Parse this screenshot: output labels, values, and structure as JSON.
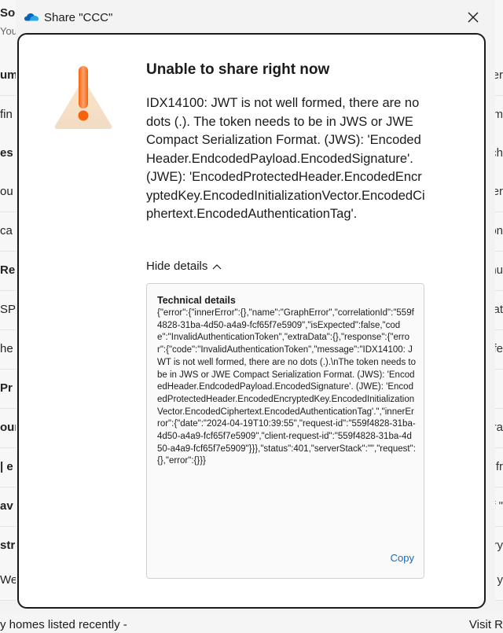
{
  "window": {
    "title": "Share \"CCC\""
  },
  "dialog": {
    "heading": "Unable to share right now",
    "message": "IDX14100: JWT is not well formed, there are no dots (.). The token needs to be in JWS or JWE Compact Serialization Format. (JWS): 'EncodedHeader.EndcodedPayload.EncodedSignature'. (JWE): 'EncodedProtectedHeader.EncodedEncryptedKey.EncodedInitializationVector.EncodedCiphertext.EncodedAuthenticationTag'.",
    "details_toggle": "Hide details",
    "tech_title": "Technical details",
    "tech_body": "{\"error\":{\"innerError\":{},\"name\":\"GraphError\",\"correlationId\":\"559f4828-31ba-4d50-a4a9-fcf65f7e5909\",\"isExpected\":false,\"code\":\"InvalidAuthenticationToken\",\"extraData\":{},\"response\":{\"error\":{\"code\":\"InvalidAuthenticationToken\",\"message\":\"IDX14100: JWT is not well formed, there are no dots (.).\\nThe token needs to be in JWS or JWE Compact Serialization Format. (JWS): 'EncodedHeader.EndcodedPayload.EncodedSignature'. (JWE): 'EncodedProtectedHeader.EncodedEncryptedKey.EncodedInitializationVector.EncodedCiphertext.EncodedAuthenticationTag'.\",\"innerError\":{\"date\":\"2024-04-19T10:39:55\",\"request-id\":\"559f4828-31ba-4d50-a4a9-fcf65f7e5909\",\"client-request-id\":\"559f4828-31ba-4d50-a4a9-fcf65f7e5909\"}}},\"status\":401,\"serverStack\":\"\",\"request\":{},\"error\":{}}}",
    "copy_label": "Copy"
  },
  "background": {
    "rows": [
      {
        "left": "So",
        "right": "",
        "bold": true
      },
      {
        "left": "You",
        "right": "",
        "bold": false
      },
      {
        "left": "um",
        "right": "ser",
        "bold": true
      },
      {
        "left": " fin",
        "right": "kim",
        "bold": false
      },
      {
        "left": "es",
        "right": "sch",
        "bold": true
      },
      {
        "left": "ou p",
        "right": "ter",
        "bold": false
      },
      {
        "left": "ca",
        "right": "on",
        "bold": false
      },
      {
        "left": "Re",
        "right": "nu",
        "bold": true
      },
      {
        "left": "SPI",
        "right": "at",
        "bold": false
      },
      {
        "left": "he",
        "right": "fe",
        "bold": false
      },
      {
        "left": "Pr",
        "right": "",
        "bold": true
      },
      {
        "left": "our",
        "right": "tra",
        "bold": true
      },
      {
        "left": "| e",
        "right": "fr",
        "bold": true
      },
      {
        "left": " av",
        "right": "of \"",
        "bold": true
      },
      {
        "left": "str",
        "right": "ary",
        "bold": true
      },
      {
        "left": "We s",
        "right": "of y",
        "bold": false
      }
    ],
    "bottom_left": "y homes listed recently -",
    "bottom_right": "Visit R"
  },
  "icons": {
    "app": "onedrive-cloud-icon",
    "close": "close-icon",
    "warning": "warning-icon",
    "chevron": "chevron-up-icon"
  },
  "colors": {
    "link": "#0f6cbd",
    "warning_orange": "#f7630c"
  }
}
